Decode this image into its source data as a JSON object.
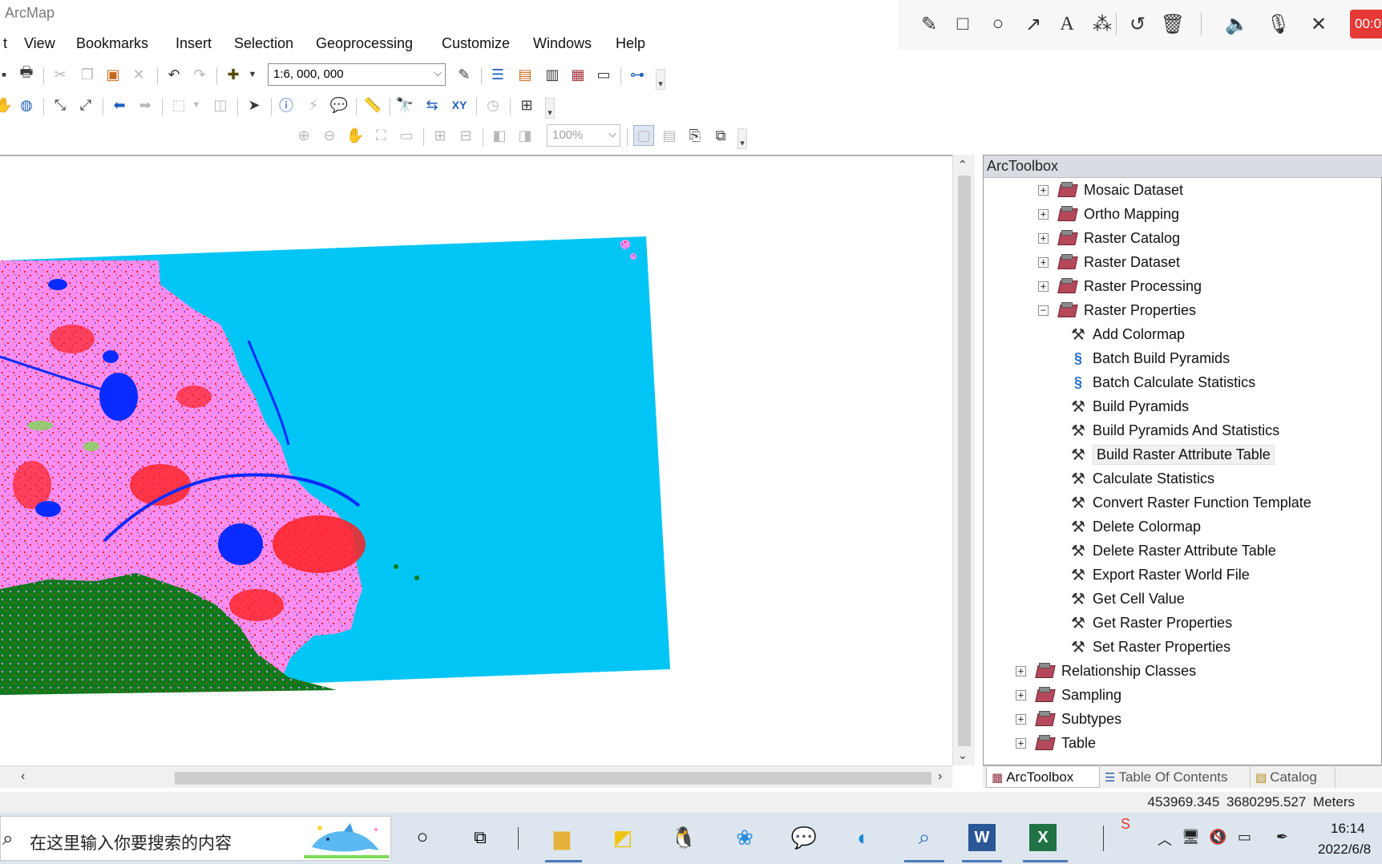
{
  "window": {
    "title": "ArcMap"
  },
  "menu": [
    "t",
    "View",
    "Bookmarks",
    "Insert",
    "Selection",
    "Geoprocessing",
    "Customize",
    "Windows",
    "Help"
  ],
  "toolbar": {
    "scale_value": "1:6, 000, 000",
    "layout_zoom_value": "100%"
  },
  "recorder": {
    "timer": "00:0",
    "tools": [
      "pencil-icon",
      "rectangle-icon",
      "circle-icon",
      "arrow-icon",
      "text-icon",
      "magic-wand-icon",
      "undo-icon",
      "trash-icon",
      "speaker-icon",
      "microphone-icon",
      "close-icon"
    ]
  },
  "map": {
    "colors": {
      "water": "#00c5f5",
      "urban": "#ff2020",
      "cropland": "#ff8cf0",
      "forest": "#0a7a1a",
      "lake": "#0a2bff",
      "grass": "#7ed957"
    }
  },
  "toolbox": {
    "title": "ArcToolbox",
    "items": [
      {
        "label": "Mosaic Dataset",
        "kind": "toolset",
        "level": 2,
        "expander": "+"
      },
      {
        "label": "Ortho Mapping",
        "kind": "toolset",
        "level": 2,
        "expander": "+"
      },
      {
        "label": "Raster Catalog",
        "kind": "toolset",
        "level": 2,
        "expander": "+"
      },
      {
        "label": "Raster Dataset",
        "kind": "toolset",
        "level": 2,
        "expander": "+"
      },
      {
        "label": "Raster Processing",
        "kind": "toolset",
        "level": 2,
        "expander": "+"
      },
      {
        "label": "Raster Properties",
        "kind": "toolset",
        "level": 2,
        "expander": "−"
      },
      {
        "label": "Add Colormap",
        "kind": "tool",
        "level": 3
      },
      {
        "label": "Batch Build Pyramids",
        "kind": "script",
        "level": 3
      },
      {
        "label": "Batch Calculate Statistics",
        "kind": "script",
        "level": 3
      },
      {
        "label": "Build Pyramids",
        "kind": "tool",
        "level": 3
      },
      {
        "label": "Build Pyramids And Statistics",
        "kind": "tool",
        "level": 3
      },
      {
        "label": "Build Raster Attribute Table",
        "kind": "tool",
        "level": 3,
        "selected": true
      },
      {
        "label": "Calculate Statistics",
        "kind": "tool",
        "level": 3
      },
      {
        "label": "Convert Raster Function Template",
        "kind": "tool",
        "level": 3
      },
      {
        "label": "Delete Colormap",
        "kind": "tool",
        "level": 3
      },
      {
        "label": "Delete Raster Attribute Table",
        "kind": "tool",
        "level": 3
      },
      {
        "label": "Export Raster World File",
        "kind": "tool",
        "level": 3
      },
      {
        "label": "Get Cell Value",
        "kind": "tool",
        "level": 3
      },
      {
        "label": "Get Raster Properties",
        "kind": "tool",
        "level": 3
      },
      {
        "label": "Set Raster Properties",
        "kind": "tool",
        "level": 3
      },
      {
        "label": "Relationship Classes",
        "kind": "toolset",
        "level": 1,
        "expander": "+"
      },
      {
        "label": "Sampling",
        "kind": "toolset",
        "level": 1,
        "expander": "+"
      },
      {
        "label": "Subtypes",
        "kind": "toolset",
        "level": 1,
        "expander": "+"
      },
      {
        "label": "Table",
        "kind": "toolset",
        "level": 1,
        "expander": "+"
      }
    ],
    "tabs": [
      "ArcToolbox",
      "Table Of Contents",
      "Catalog"
    ]
  },
  "status": {
    "coordinates": "453969.345  3680295.527 Meters"
  },
  "taskbar": {
    "search_placeholder": "在这里输入你要搜索的内容",
    "time": "16:14",
    "date": "2022/6/8"
  }
}
